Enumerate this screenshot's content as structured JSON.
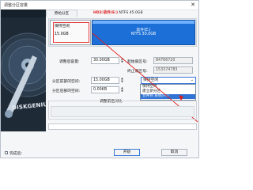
{
  "window": {
    "title": "调整分区容量",
    "close_label": "✕"
  },
  "left_panel": {
    "brand_text": "DISKGENIUS"
  },
  "tabs": [
    {
      "label": "原始分区"
    },
    {
      "label_highlight": "HD2:软件(E:)",
      "label_rest": " NTFS 45.0GB"
    }
  ],
  "partitions": {
    "new": {
      "name": "保持空闲",
      "size": "15.0GB"
    },
    "used": {
      "name": "软件(E:)",
      "detail": "NTFS 30.0GB"
    }
  },
  "fields": {
    "adjusted_capacity": {
      "label": "调整后容量:",
      "value": "30.00GB"
    },
    "start_sector": {
      "label": "起始扇区号:",
      "value": "84766720"
    },
    "end_sector": {
      "label": "终止扇区号:",
      "value": "153374783"
    },
    "front_space": {
      "label": "分区前部的空间:",
      "value": "15.00GB"
    },
    "rear_space": {
      "label": "分区后部的空间:",
      "value": "0.00KB"
    },
    "front_action": {
      "selected": "保持空闲"
    }
  },
  "dropdown_options": [
    "保持空闲",
    "建立新分区",
    "合并到 系统(H:)"
  ],
  "dropdown_selected_index": 2,
  "group": {
    "title": "调整前后对比"
  },
  "footer": {
    "checkbox_label": "完成后:",
    "start_button": "开始",
    "cancel_button": "取消"
  },
  "colors": {
    "accent": "#2f73d4",
    "partition_used": "#1b6fd6",
    "highlight_red": "#e01a1a"
  }
}
